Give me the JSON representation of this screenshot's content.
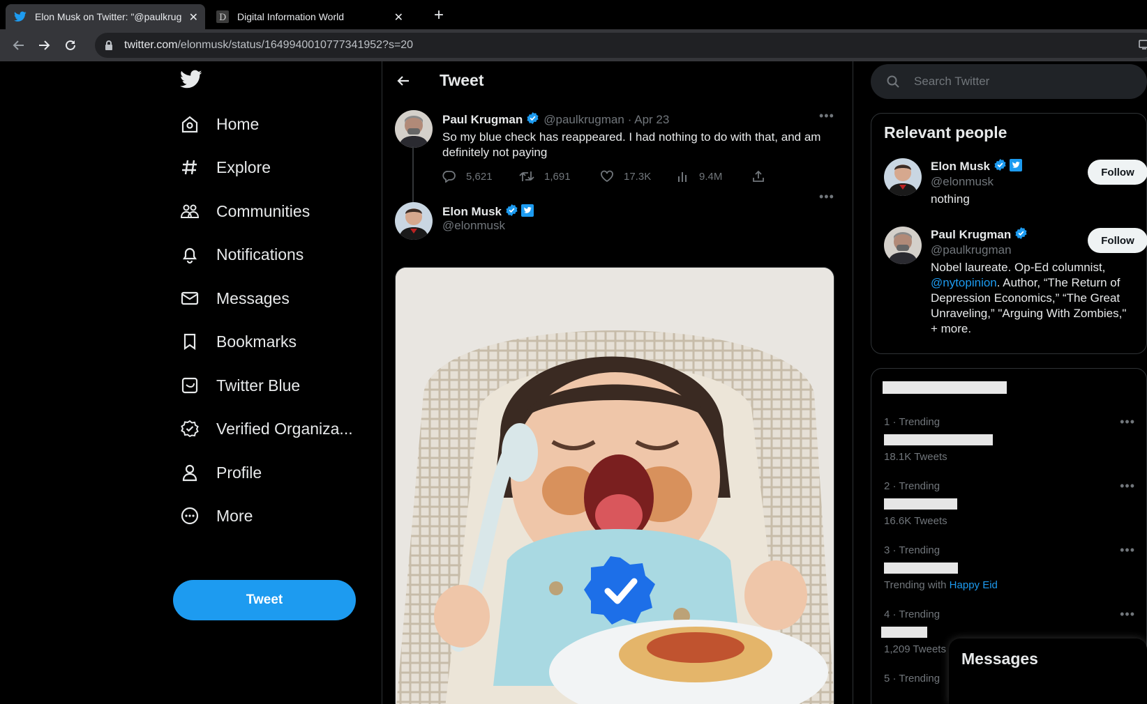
{
  "browser": {
    "tabs": [
      {
        "title": "Elon Musk on Twitter: \"@paulkrugman",
        "active": true,
        "favicon": "twitter-bird-icon"
      },
      {
        "title": "Digital Information World",
        "active": false,
        "favicon": "dim-site-icon"
      }
    ],
    "url_host": "twitter.com",
    "url_path": "/elonmusk/status/1649940010777341952?s=20"
  },
  "nav": {
    "items": [
      {
        "label": "Home",
        "icon": "home-icon"
      },
      {
        "label": "Explore",
        "icon": "hashtag-icon"
      },
      {
        "label": "Communities",
        "icon": "communities-icon"
      },
      {
        "label": "Notifications",
        "icon": "bell-icon"
      },
      {
        "label": "Messages",
        "icon": "envelope-icon"
      },
      {
        "label": "Bookmarks",
        "icon": "bookmark-icon"
      },
      {
        "label": "Twitter Blue",
        "icon": "twitter-blue-icon"
      },
      {
        "label": "Verified Organiza...",
        "icon": "verified-org-icon"
      },
      {
        "label": "Profile",
        "icon": "person-icon"
      },
      {
        "label": "More",
        "icon": "more-circle-icon"
      }
    ],
    "tweet_button": "Tweet"
  },
  "main": {
    "title": "Tweet",
    "quoted_tweet": {
      "name": "Paul Krugman",
      "handle": "@paulkrugman",
      "date": "· Apr 23",
      "text": "So my blue check has reappeared. I had nothing to do with that, and am definitely not paying",
      "replies": "5,621",
      "retweets": "1,691",
      "likes": "17.3K",
      "views": "9.4M"
    },
    "reply_tweet": {
      "name": "Elon Musk",
      "handle": "@elonmusk"
    }
  },
  "right": {
    "search_placeholder": "Search Twitter",
    "relevant_people": {
      "title": "Relevant people",
      "people": [
        {
          "name": "Elon Musk",
          "handle": "@elonmusk",
          "bio": "nothing",
          "follow": "Follow"
        },
        {
          "name": "Paul Krugman",
          "handle": "@paulkrugman",
          "bio_link": "@nytopinion",
          "bio_pre": "Nobel laureate. Op-Ed columnist, ",
          "bio_post": ". Author, “The Return of Depression Economics,” “The Great Unraveling,” \"Arguing With Zombies,\" + more.",
          "follow": "Follow"
        }
      ]
    },
    "trends": [
      {
        "category": "1 · Trending",
        "meta": "18.1K Tweets"
      },
      {
        "category": "2 · Trending",
        "meta": "16.6K Tweets"
      },
      {
        "category": "3 · Trending",
        "meta_prefix": "Trending with",
        "meta_link": "Happy Eid"
      },
      {
        "category": "4 · Trending",
        "meta": "1,209 Tweets"
      },
      {
        "category": "5 · Trending"
      }
    ],
    "messages_drawer": "Messages"
  },
  "colors": {
    "accent": "#1d9bf0",
    "background": "#000000",
    "border": "#2f3336",
    "muted": "#71767b"
  }
}
